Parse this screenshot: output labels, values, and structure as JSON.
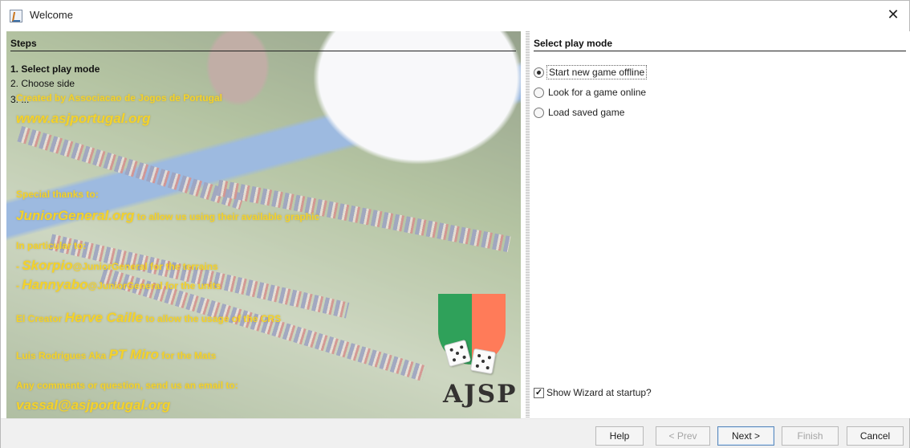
{
  "window": {
    "title": "Welcome",
    "close_label": "✕"
  },
  "steps": {
    "heading": "Steps",
    "items": [
      "1. Select play mode",
      "2. Choose side",
      "3. ..."
    ]
  },
  "credits": {
    "created_by": "Created by Associacao de Jogos de Portugal",
    "site": "www.asjportugal.org",
    "special_thanks": "Special thanks to:",
    "junior_general": "JuniorGeneral.org",
    "allow_graphics": "to allow us using their available graphic",
    "in_particular": "In particular to:",
    "skorpio": "Skorpio",
    "skorpio_text": "@JuniorGeneral for the terrains",
    "hannyabo": "Hannyabo",
    "hannyabo_text": "@JuniorGeneral for the units",
    "el_creator": "El Creator",
    "herve": "Herve Caille",
    "herve_text": "to allow the usage of the CRS",
    "luis": "Luis Rodrigues Aka",
    "pt_miro": "PT Miro",
    "mats_text": "for the Mats",
    "comments": "Any comments or question, send us an email to:",
    "email": "vassal@asjportugal.org",
    "logo_text": "AJSP"
  },
  "play_mode": {
    "heading": "Select play mode",
    "options": [
      {
        "label": "Start new game offline",
        "selected": true
      },
      {
        "label": "Look for a game online",
        "selected": false
      },
      {
        "label": "Load saved game",
        "selected": false
      }
    ],
    "show_wizard": {
      "label": "Show Wizard at startup?",
      "checked": true
    }
  },
  "buttons": {
    "help": "Help",
    "prev": "< Prev",
    "next": "Next >",
    "finish": "Finish",
    "cancel": "Cancel"
  },
  "colors": {
    "credit_yellow": "#f4d22a",
    "flag_green": "#2fa15a",
    "flag_orange": "#ff7b59"
  }
}
